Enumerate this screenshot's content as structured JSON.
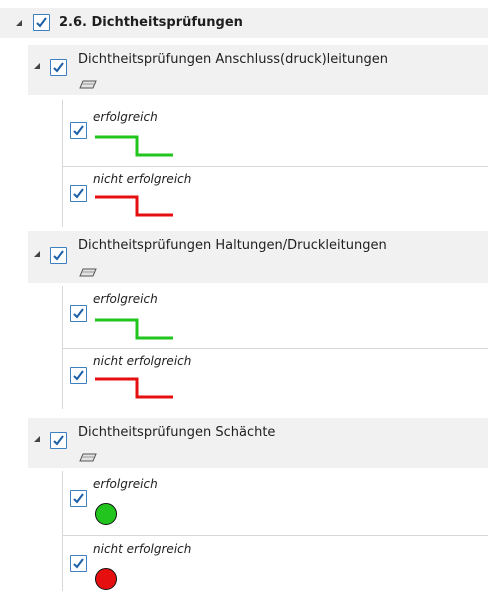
{
  "root": {
    "label": "2.6. Dichtheitsprüfungen",
    "checked": true,
    "expanded": true
  },
  "groups": [
    {
      "label": "Dichtheitsprüfungen Anschluss(druck)leitungen",
      "icon": "layer-icon",
      "checked": true,
      "items": [
        {
          "label": "erfolgreich",
          "checked": true,
          "symbol": "step-line",
          "color": "#22c51e"
        },
        {
          "label": "nicht erfolgreich",
          "checked": true,
          "symbol": "step-line",
          "color": "#e60f0f"
        }
      ]
    },
    {
      "label": "Dichtheitsprüfungen Haltungen/Druckleitungen",
      "icon": "layer-icon",
      "checked": true,
      "items": [
        {
          "label": "erfolgreich",
          "checked": true,
          "symbol": "step-line",
          "color": "#22c51e"
        },
        {
          "label": "nicht erfolgreich",
          "checked": true,
          "symbol": "step-line",
          "color": "#e60f0f"
        }
      ]
    },
    {
      "label": "Dichtheitsprüfungen Schächte",
      "icon": "layer-icon",
      "checked": true,
      "items": [
        {
          "label": "erfolgreich",
          "checked": true,
          "symbol": "filled-circle",
          "color": "#22c51e"
        },
        {
          "label": "nicht erfolgreich",
          "checked": true,
          "symbol": "filled-circle",
          "color": "#e60f0f"
        }
      ]
    }
  ],
  "colors": {
    "checkbox_border": "#3e7fc1",
    "checkmark": "#1c5fa8",
    "row_background": "#f1f1f1"
  }
}
